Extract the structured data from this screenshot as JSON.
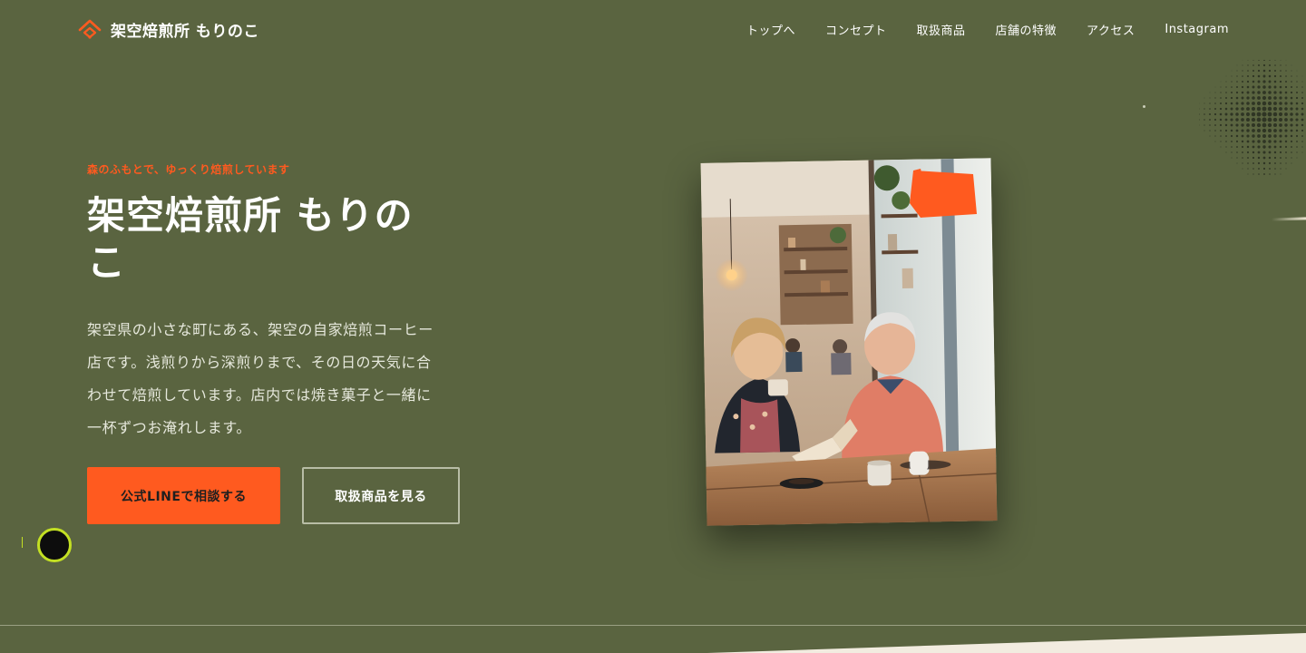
{
  "brand": {
    "name": "架空焙煎所 もりのこ",
    "accent": "#ff5a1f",
    "background": "#5a6440"
  },
  "nav": {
    "items": [
      "トップへ",
      "コンセプト",
      "取扱商品",
      "店舗の特徴",
      "アクセス",
      "Instagram"
    ]
  },
  "hero": {
    "eyebrow": "森のふもとで、ゆっくり焙煎しています",
    "title_line1": "架空焙煎所 もりの",
    "title_line2": "こ",
    "desc_lines": [
      "架空県の小さな町にある、架空の自家焙煎コーヒー",
      "店です。浅煎りから深煎りまで、その日の天気に合",
      "わせて焙煎しています。店内では焼き菓子と一緒に",
      "一杯ずつお淹れします。"
    ],
    "cta_primary": "公式LINEで相談する",
    "cta_secondary": "取扱商品を見る"
  },
  "icons": {
    "logo": "house-roof-icon"
  }
}
